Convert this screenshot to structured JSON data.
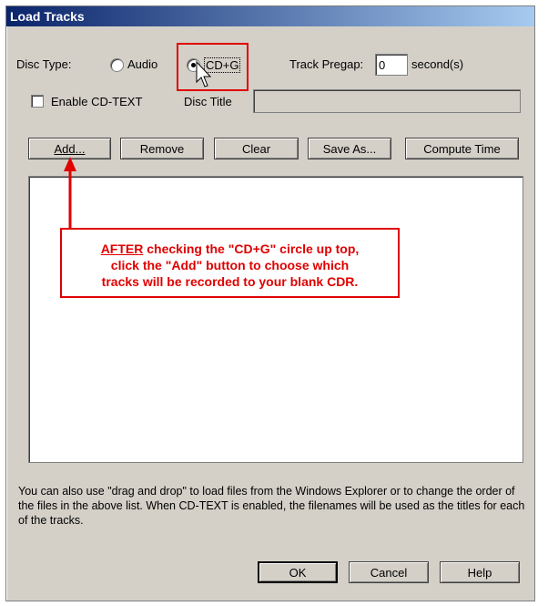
{
  "window": {
    "title": "Load Tracks"
  },
  "disc_type": {
    "label": "Disc Type:",
    "options": [
      {
        "label": "Audio",
        "selected": false
      },
      {
        "label": "CD+G",
        "selected": true
      }
    ]
  },
  "pregap": {
    "label": "Track Pregap:",
    "value": "0",
    "unit": "second(s)"
  },
  "cdtext": {
    "label": "Enable CD-TEXT",
    "checked": false
  },
  "disc_title": {
    "label": "Disc Title",
    "value": ""
  },
  "buttons": {
    "add": "Add...",
    "remove": "Remove",
    "clear": "Clear",
    "save_as": "Save As...",
    "compute_time": "Compute Time",
    "ok": "OK",
    "cancel": "Cancel",
    "help": "Help"
  },
  "annotation": {
    "underlined": "AFTER",
    "line1_rest": " checking the \"CD+G\" circle up top,",
    "line2": "click the \"Add\" button to choose which",
    "line3": "tracks will be recorded to your blank CDR."
  },
  "note": "You can also use \"drag and drop\" to load files from the Windows Explorer or to change the order of the files in the above list. When CD-TEXT is enabled, the filenames will be used as the titles for each of the tracks.",
  "colors": {
    "annotation_red": "#e00000",
    "title_start": "#0a246a",
    "title_end": "#a6caf0",
    "face": "#d4d0c8"
  }
}
